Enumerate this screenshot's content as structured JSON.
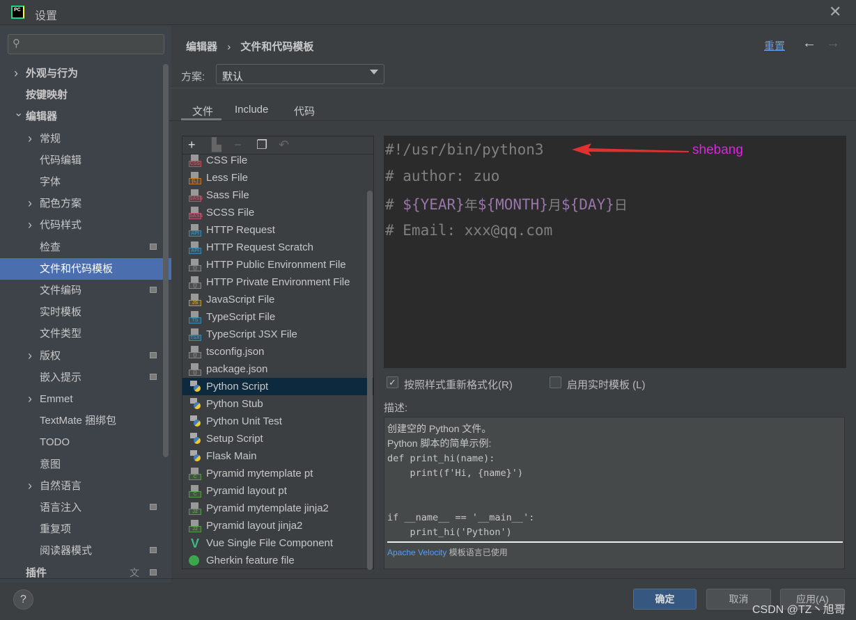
{
  "window": {
    "title": "设置",
    "app_icon": "pycharm-logo"
  },
  "search": {
    "placeholder": ""
  },
  "sidebar": {
    "items": [
      {
        "label": "外观与行为",
        "chevron": "right",
        "level": 0,
        "bold": true
      },
      {
        "label": "按键映射",
        "level": 0,
        "bold": true
      },
      {
        "label": "编辑器",
        "chevron": "down",
        "level": 0,
        "bold": true
      },
      {
        "label": "常规",
        "chevron": "right",
        "level": 1
      },
      {
        "label": "代码编辑",
        "level": 1
      },
      {
        "label": "字体",
        "level": 1
      },
      {
        "label": "配色方案",
        "chevron": "right",
        "level": 1
      },
      {
        "label": "代码样式",
        "chevron": "right",
        "level": 1
      },
      {
        "label": "检查",
        "level": 1,
        "cfg": true
      },
      {
        "label": "文件和代码模板",
        "level": 1,
        "selected": true
      },
      {
        "label": "文件编码",
        "level": 1,
        "cfg": true
      },
      {
        "label": "实时模板",
        "level": 1
      },
      {
        "label": "文件类型",
        "level": 1
      },
      {
        "label": "版权",
        "chevron": "right",
        "level": 1,
        "cfg": true
      },
      {
        "label": "嵌入提示",
        "level": 1,
        "cfg": true
      },
      {
        "label": "Emmet",
        "chevron": "right",
        "level": 1
      },
      {
        "label": "TextMate 捆绑包",
        "level": 1
      },
      {
        "label": "TODO",
        "level": 1
      },
      {
        "label": "意图",
        "level": 1
      },
      {
        "label": "自然语言",
        "chevron": "right",
        "level": 1
      },
      {
        "label": "语言注入",
        "level": 1,
        "cfg": true
      },
      {
        "label": "重复项",
        "level": 1
      },
      {
        "label": "阅读器模式",
        "level": 1,
        "cfg": true
      },
      {
        "label": "插件",
        "level": 0,
        "bold": true,
        "cfg": true
      }
    ]
  },
  "breadcrumb": {
    "parent": "编辑器",
    "separator": "›",
    "current": "文件和代码模板"
  },
  "header": {
    "reset_label": "重置"
  },
  "scheme": {
    "label": "方案:",
    "value": "默认"
  },
  "tabs": [
    {
      "label": "文件",
      "active": true
    },
    {
      "label": "Include"
    },
    {
      "label": "代码"
    }
  ],
  "list": {
    "items": [
      {
        "label": "CSS File",
        "icon": "CSS",
        "color": "#c0505a"
      },
      {
        "label": "Less File",
        "icon": "{L}",
        "color": "#c07830"
      },
      {
        "label": "Sass File",
        "icon": "SASS",
        "color": "#c0506a"
      },
      {
        "label": "SCSS File",
        "icon": "SASS",
        "color": "#c0506a"
      },
      {
        "label": "HTTP Request",
        "icon": "API",
        "color": "#3a8ab0"
      },
      {
        "label": "HTTP Request Scratch",
        "icon": "API",
        "color": "#3a8ab0"
      },
      {
        "label": "HTTP Public Environment File",
        "icon": "{}",
        "color": "#888888"
      },
      {
        "label": "HTTP Private Environment File",
        "icon": "{}",
        "color": "#888888"
      },
      {
        "label": "JavaScript File",
        "icon": "JS",
        "color": "#c09a30"
      },
      {
        "label": "TypeScript File",
        "icon": "TS",
        "color": "#3a8ab0"
      },
      {
        "label": "TypeScript JSX File",
        "icon": "TSX",
        "color": "#3a8ab0"
      },
      {
        "label": "tsconfig.json",
        "icon": "{}",
        "color": "#888888"
      },
      {
        "label": "package.json",
        "icon": "{}",
        "color": "#888888"
      },
      {
        "label": "Python Script",
        "icon": "PY",
        "color": "#3f7fbf",
        "selected": true
      },
      {
        "label": "Python Stub",
        "icon": "PY",
        "color": "#3f7fbf"
      },
      {
        "label": "Python Unit Test",
        "icon": "PY",
        "color": "#3f7fbf"
      },
      {
        "label": "Setup Script",
        "icon": "PY",
        "color": "#3f7fbf"
      },
      {
        "label": "Flask Main",
        "icon": "PY",
        "color": "#3f7fbf"
      },
      {
        "label": "Pyramid mytemplate pt",
        "icon": "C",
        "color": "#5a9a4a"
      },
      {
        "label": "Pyramid layout pt",
        "icon": "C",
        "color": "#5a9a4a"
      },
      {
        "label": "Pyramid mytemplate jinja2",
        "icon": "J2",
        "color": "#5a9a4a"
      },
      {
        "label": "Pyramid layout jinja2",
        "icon": "J2",
        "color": "#5a9a4a"
      },
      {
        "label": "Vue Single File Component",
        "icon": "V",
        "color": "#41b883"
      },
      {
        "label": "Gherkin feature file",
        "icon": "G",
        "color": "#3aa84a"
      }
    ]
  },
  "editor": {
    "lines": [
      "#!/usr/bin/python3",
      "# author: zuo",
      "# ",
      "${YEAR}",
      "年",
      "${MONTH}",
      "月",
      "${DAY}",
      "日",
      "# Email: xxx@qq.com"
    ],
    "annotation": "shebang",
    "annotation_color": "#e61ee6",
    "arrow_color": "#e03030"
  },
  "options": {
    "reformat": {
      "label": "按照样式重新格式化(R)",
      "checked": true
    },
    "live": {
      "label": "启用实时模板 (L)",
      "checked": false
    }
  },
  "description": {
    "label": "描述:",
    "lines": [
      "创建空的 Python 文件。",
      "Python 脚本的简单示例:",
      "def print_hi(name):",
      "    print(f'Hi, {name}')",
      "",
      "",
      "if __name__ == '__main__':",
      "    print_hi('Python')"
    ],
    "footer_link": "Apache Velocity",
    "footer_text": " 模板语言已使用"
  },
  "footer": {
    "ok": "确定",
    "cancel": "取消",
    "apply": "应用(A)",
    "watermark": "CSDN @TZ丶旭哥"
  },
  "colors": {
    "accent": "#4b6eaf",
    "link": "#589df6",
    "ok_button": "#365880"
  }
}
